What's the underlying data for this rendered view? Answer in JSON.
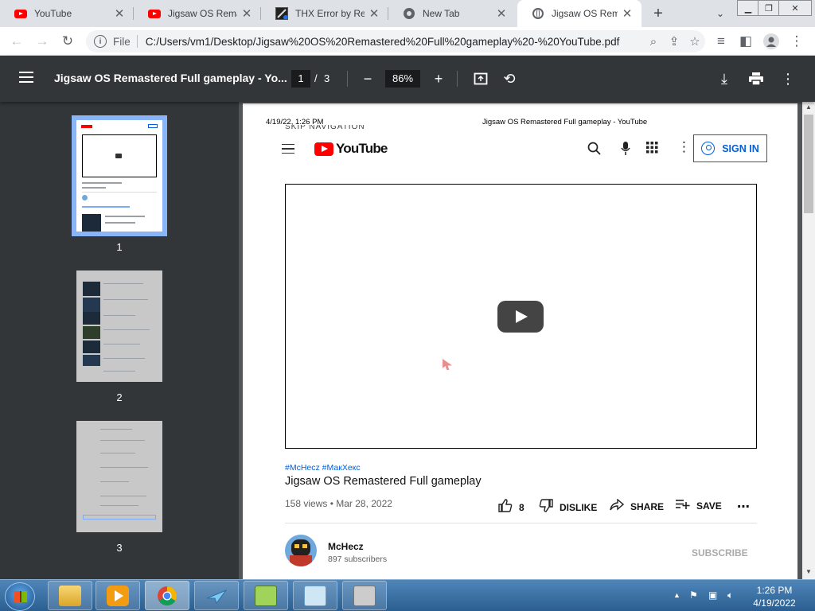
{
  "tabs": [
    {
      "title": "YouTube",
      "favicon": "youtube-icon",
      "active": false
    },
    {
      "title": "Jigsaw OS Remastered",
      "favicon": "youtube-icon",
      "active": false
    },
    {
      "title": "THX Error by Recording",
      "favicon": "thx-icon",
      "active": false
    },
    {
      "title": "New Tab",
      "favicon": "chrome-icon",
      "active": false
    },
    {
      "title": "Jigsaw OS Remastered",
      "favicon": "globe-icon",
      "active": true
    }
  ],
  "toolbar": {
    "scheme": "File",
    "url": "C:/Users/vm1/Desktop/Jigsaw%20OS%20Remastered%20Full%20gameplay%20-%20YouTube.pdf"
  },
  "pdf": {
    "title": "Jigsaw OS Remastered Full gameplay - Yo...",
    "page": "1",
    "total": "3",
    "zoom": "86%"
  },
  "thumbnails": [
    {
      "label": "1",
      "selected": true
    },
    {
      "label": "2",
      "selected": false
    },
    {
      "label": "3",
      "selected": false
    }
  ],
  "page": {
    "date": "4/19/22, 1:26 PM",
    "header_title": "Jigsaw OS Remastered Full gameplay - YouTube",
    "skip_text": "SKIP NAVIGATION",
    "logo": "YouTube",
    "signin": "SIGN IN",
    "hashtags": "#McHecz #МакХекс",
    "video_title": "Jigsaw OS Remastered Full gameplay",
    "meta": "158 views • Mar 28, 2022",
    "likes": "8",
    "dislike": "DISLIKE",
    "share": "SHARE",
    "save": "SAVE",
    "channel": "McHecz",
    "subscribers": "897 subscribers",
    "subscribe": "SUBSCRIBE"
  },
  "taskbar": {
    "time": "1:26 PM",
    "date": "4/19/2022"
  },
  "colors": {
    "accent": "#065fd4",
    "youtube_red": "#ff0000",
    "pdf_toolbar": "#323639",
    "viewer_bg": "#525659",
    "thumb_selected": "#8ab4f8"
  }
}
